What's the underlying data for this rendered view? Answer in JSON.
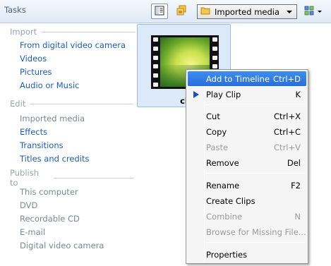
{
  "toolbar": {
    "tasks_title": "Tasks",
    "collection_label": "Imported media"
  },
  "tasks": {
    "import": {
      "heading": "Import",
      "items": [
        "From digital video camera",
        "Videos",
        "Pictures",
        "Audio or Music"
      ]
    },
    "edit": {
      "heading": "Edit",
      "items": [
        "Imported media",
        "Effects",
        "Transitions",
        "Titles and credits"
      ]
    },
    "publish": {
      "heading": "Publish to",
      "items": [
        "This computer",
        "DVD",
        "Recordable CD",
        "E-mail",
        "Digital video camera"
      ]
    }
  },
  "clip": {
    "name": "cl"
  },
  "context_menu": {
    "items": [
      {
        "label": "Add to Timeline",
        "shortcut": "Ctrl+D",
        "state": "highlighted"
      },
      {
        "label": "Play Clip",
        "shortcut": "K",
        "icon": "play-icon"
      },
      {
        "label": "Cut",
        "shortcut": "Ctrl+X"
      },
      {
        "label": "Copy",
        "shortcut": "Ctrl+C"
      },
      {
        "label": "Paste",
        "shortcut": "Ctrl+V",
        "state": "disabled"
      },
      {
        "label": "Remove",
        "shortcut": "Del"
      },
      {
        "label": "Rename",
        "shortcut": "F2"
      },
      {
        "label": "Create Clips",
        "shortcut": ""
      },
      {
        "label": "Combine",
        "shortcut": "N",
        "state": "disabled"
      },
      {
        "label": "Browse for Missing File...",
        "shortcut": "",
        "state": "disabled"
      },
      {
        "label": "Properties",
        "shortcut": ""
      }
    ]
  },
  "colors": {
    "link": "#1a5dbd",
    "muted": "#7c8792",
    "highlight": "#3f8cf3",
    "selection_tile": "#dce9f8"
  }
}
